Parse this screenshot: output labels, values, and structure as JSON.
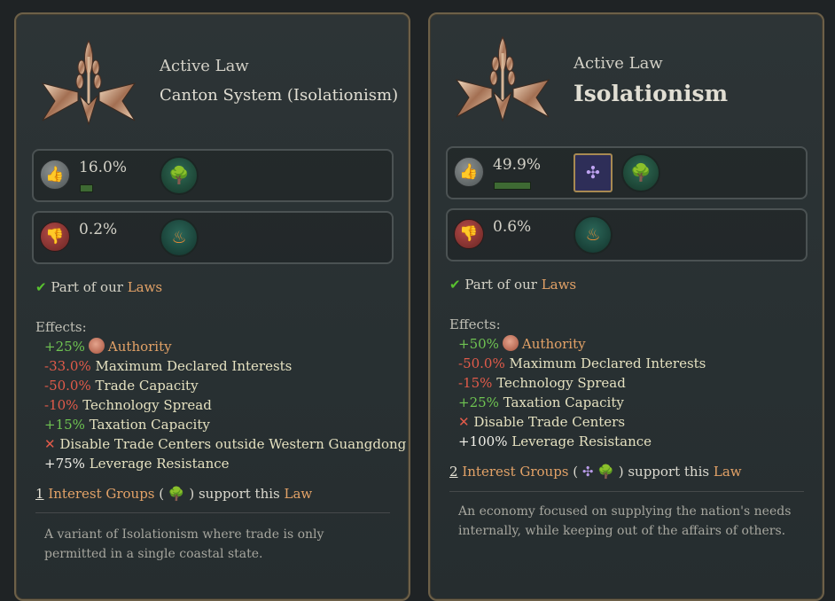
{
  "left": {
    "header_label": "Active Law",
    "law_name": "Canton System (Isolationism)",
    "approve_pct": "16.0%",
    "approve_fraction": 0.16,
    "disapprove_pct": "0.2%",
    "part_of_prefix": "Part of our",
    "part_of_link": "Laws",
    "effects_label": "Effects:",
    "effects": [
      {
        "value": "+25%",
        "label": "Authority"
      },
      {
        "value": "-33.0%",
        "label": "Maximum Declared Interests"
      },
      {
        "value": "-50.0%",
        "label": "Trade Capacity"
      },
      {
        "value": "-10%",
        "label": "Technology Spread"
      },
      {
        "value": "+15%",
        "label": "Taxation Capacity"
      },
      {
        "value": "✕",
        "label": "Disable Trade Centers outside Western Guangdong"
      },
      {
        "value": "+75%",
        "label": "Leverage Resistance"
      }
    ],
    "support_count": "1",
    "support_link": "Interest Groups",
    "support_mid": "support this",
    "support_end": "Law",
    "description": "A variant of Isolationism where trade is only permitted in a single coastal state."
  },
  "right": {
    "header_label": "Active Law",
    "law_name": "Isolationism",
    "approve_pct": "49.9%",
    "approve_fraction": 0.499,
    "disapprove_pct": "0.6%",
    "part_of_prefix": "Part of our",
    "part_of_link": "Laws",
    "effects_label": "Effects:",
    "effects": [
      {
        "value": "+50%",
        "label": "Authority"
      },
      {
        "value": "-50.0%",
        "label": "Maximum Declared Interests"
      },
      {
        "value": "-15%",
        "label": "Technology Spread"
      },
      {
        "value": "+25%",
        "label": "Taxation Capacity"
      },
      {
        "value": "✕",
        "label": "Disable Trade Centers"
      },
      {
        "value": "+100%",
        "label": "Leverage Resistance"
      }
    ],
    "support_count": "2",
    "support_link": "Interest Groups",
    "support_mid": "support this",
    "support_end": "Law",
    "description": "An economy focused on supplying the nation's needs internally, while keeping out of the affairs of others."
  },
  "icons": {
    "approve": "thumbs-up-icon",
    "disapprove": "thumbs-down-icon",
    "rural_folk": "tree-icon",
    "landowners": "brazier-icon",
    "industrialists": "windmill-icon",
    "authority": "authority-icon",
    "check": "checkmark-icon",
    "cross": "cross-icon"
  },
  "colors": {
    "positive": "#6fc452",
    "negative": "#e25b4a",
    "link": "#e3a267",
    "approval_bar": "#3e6a33"
  }
}
